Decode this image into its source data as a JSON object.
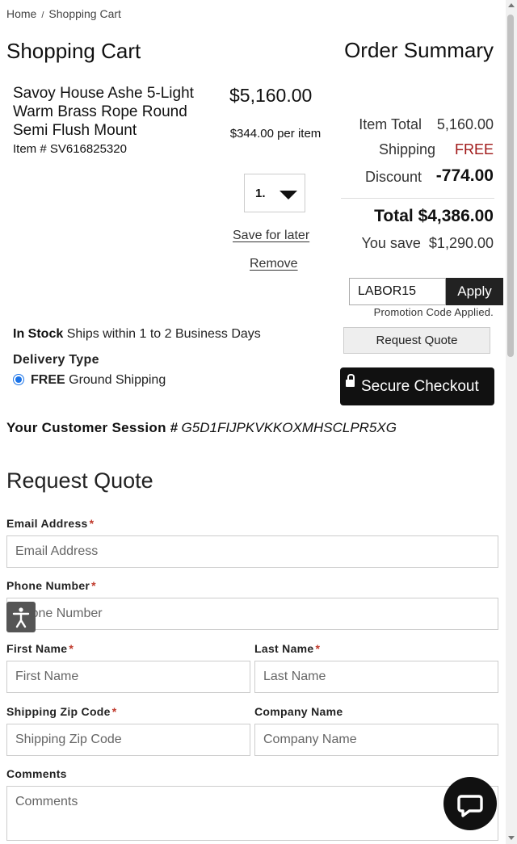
{
  "breadcrumb": {
    "home": "Home",
    "separator": "/",
    "current": "Shopping Cart"
  },
  "cart": {
    "title": "Shopping Cart",
    "product": {
      "name": "Savoy House Ashe 5-Light Warm Brass Rope Round Semi Flush Mount",
      "item_number": "Item # SV616825320",
      "price": "$5,160.00",
      "unit_price": "$344.00 per item",
      "quantity": "1.",
      "save_for_later": "Save for later",
      "remove": "Remove"
    },
    "stock": {
      "status": "In Stock",
      "ships": "Ships within 1 to 2 Business Days"
    },
    "delivery": {
      "label": "Delivery Type",
      "option_free": "FREE",
      "option_name": "Ground Shipping",
      "selected": true
    }
  },
  "summary": {
    "title": "Order Summary",
    "item_total_label": "Item Total",
    "item_total": "5,160.00",
    "shipping_label": "Shipping",
    "shipping": "FREE",
    "discount_label": "Discount",
    "discount": "-774.00",
    "total_label": "Total",
    "total": "$4,386.00",
    "you_save_label": "You save",
    "you_save": "$1,290.00",
    "promo_code": "LABOR15",
    "apply_label": "Apply",
    "promo_note": "Promotion Code Applied.",
    "request_quote_label": "Request Quote",
    "checkout_label": "Secure Checkout",
    "free_color": "#a01818"
  },
  "session": {
    "label": "Your Customer Session #",
    "id": "G5D1FIJPKVKKOXMHSCLPR5XG"
  },
  "quote_form": {
    "title": "Request Quote",
    "email": {
      "label": "Email Address",
      "required": "*",
      "placeholder": "Email Address"
    },
    "phone": {
      "label": "Phone Number",
      "required": "*",
      "placeholder": "Phone Number"
    },
    "first_name": {
      "label": "First Name",
      "required": "*",
      "placeholder": "First Name"
    },
    "last_name": {
      "label": "Last Name",
      "required": "*",
      "placeholder": "Last Name"
    },
    "zip": {
      "label": "Shipping Zip Code",
      "required": "*",
      "placeholder": "Shipping Zip Code"
    },
    "company": {
      "label": "Company Name",
      "placeholder": "Company Name"
    },
    "comments": {
      "label": "Comments",
      "placeholder": "Comments"
    }
  },
  "icons": {
    "accessibility": "accessibility-icon",
    "chat": "chat-icon",
    "lock": "lock-icon",
    "dropdown": "caret-down-icon"
  }
}
